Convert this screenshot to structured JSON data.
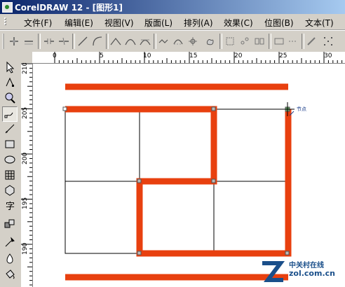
{
  "window": {
    "title": "CorelDRAW 12 - [图形1]"
  },
  "menu": {
    "items": [
      {
        "label": "文件(F)",
        "name": "menu-file"
      },
      {
        "label": "编辑(E)",
        "name": "menu-edit"
      },
      {
        "label": "视图(V)",
        "name": "menu-view"
      },
      {
        "label": "版面(L)",
        "name": "menu-layout"
      },
      {
        "label": "排列(A)",
        "name": "menu-arrange"
      },
      {
        "label": "效果(C)",
        "name": "menu-effects"
      },
      {
        "label": "位图(B)",
        "name": "menu-bitmaps"
      },
      {
        "label": "文本(T)",
        "name": "menu-text"
      }
    ]
  },
  "toolbar": {
    "buttons": [
      "add-node-icon",
      "delete-node-icon",
      "join-nodes-icon",
      "break-curve-icon",
      "to-line-icon",
      "to-curve-icon",
      "cusp-node-icon",
      "smooth-node-icon",
      "symmetrical-node-icon",
      "reverse-direction-icon",
      "extend-curve-icon",
      "extract-subpath-icon",
      "stretch-nodes-icon",
      "rotate-nodes-icon",
      "align-nodes-icon",
      "elastic-mode-icon",
      "select-all-nodes-icon",
      "reduce-nodes-icon"
    ]
  },
  "ruler_h": {
    "labels": [
      "0",
      "5",
      "10",
      "15",
      "20",
      "25",
      "30"
    ]
  },
  "ruler_v": {
    "labels": [
      "210",
      "205",
      "200",
      "195",
      "190"
    ]
  },
  "toolbox": {
    "tools": [
      "pick-tool-icon",
      "shape-tool-icon",
      "zoom-tool-icon",
      "freehand-tool-icon",
      "smart-fill-tool-icon",
      "rectangle-tool-icon",
      "ellipse-tool-icon",
      "polygon-tool-icon",
      "basic-shapes-tool-icon",
      "text-tool-icon",
      "interactive-blend-tool-icon",
      "eyedropper-tool-icon",
      "outline-tool-icon",
      "fill-tool-icon"
    ],
    "active_index": 3
  },
  "canvas": {
    "node_label": "节点",
    "stroke_color": "#e8400f",
    "grid_color": "#000000"
  },
  "watermark": {
    "cn": "中关村在线",
    "en": "zol.com.cn"
  }
}
